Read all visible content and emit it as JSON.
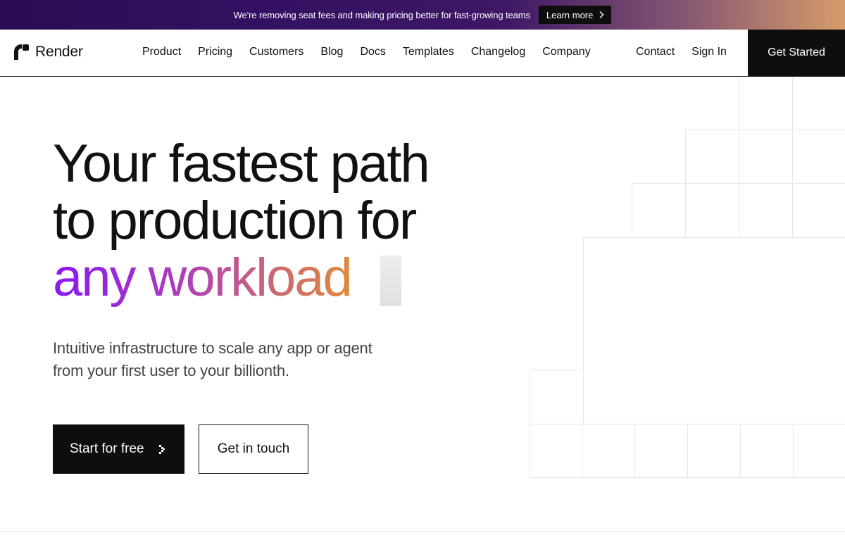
{
  "banner": {
    "text": "We're removing seat fees and making pricing better for fast-growing teams",
    "cta": "Learn more",
    "cta_icon": "chevron-right-icon"
  },
  "nav": {
    "logo_text": "Render",
    "logo_icon": "render-logo-icon",
    "links": [
      "Product",
      "Pricing",
      "Customers",
      "Blog",
      "Docs",
      "Templates",
      "Changelog",
      "Company"
    ],
    "right_links": [
      "Contact",
      "Sign In"
    ],
    "cta": "Get Started"
  },
  "hero": {
    "title_line1": "Your fastest path",
    "title_line2": "to production for",
    "title_highlight": "any workload",
    "subtitle": "Intuitive infrastructure to scale any app or agent from your first user to your billionth.",
    "primary_cta": "Start for free",
    "primary_cta_icon": "chevron-right-icon",
    "secondary_cta": "Get in touch"
  },
  "colors": {
    "banner_start": "#2a0d52",
    "banner_end": "#d79c6a",
    "dark": "#0e0e0e",
    "gradient_start": "#8b18f0",
    "gradient_end": "#df8a3a",
    "grid_line": "#e6e6e6"
  }
}
